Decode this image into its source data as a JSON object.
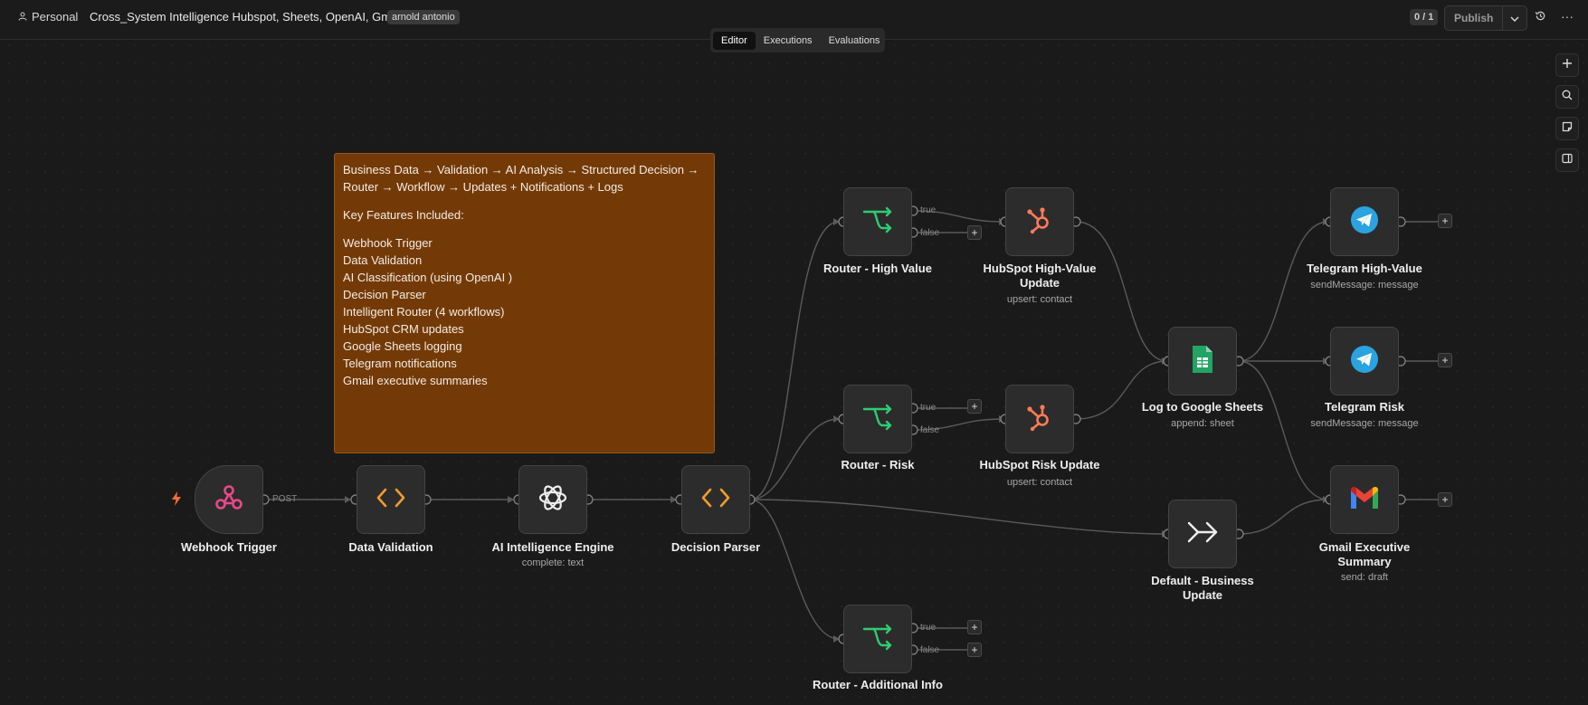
{
  "header": {
    "personal_label": "Personal",
    "workflow_title": "Cross_System Intelligence Hubspot, Sheets, OpenAI, Gmail",
    "owner_tag": "arnold antonio",
    "version_counter": "0 / 1",
    "publish_label": "Publish"
  },
  "tabs": [
    {
      "label": "Editor",
      "active": true
    },
    {
      "label": "Executions",
      "active": false
    },
    {
      "label": "Evaluations",
      "active": false
    }
  ],
  "sticky_note": {
    "flow_line": "Business Data → Validation → AI Analysis → Structured Decision → Router → Workflow → Updates + Notifications + Logs",
    "features_heading": "Key Features Included:",
    "features": [
      "Webhook Trigger",
      "Data Validation",
      "AI Classification (using OpenAI )",
      "Decision Parser",
      "Intelligent Router (4 workflows)",
      "HubSpot CRM updates",
      "Google Sheets logging",
      "Telegram notifications",
      "Gmail executive summaries"
    ]
  },
  "nodes": {
    "webhook": {
      "label": "Webhook Trigger",
      "edge_label": "POST"
    },
    "validation": {
      "label": "Data Validation"
    },
    "ai_engine": {
      "label": "AI Intelligence Engine",
      "subtitle": "complete: text"
    },
    "parser": {
      "label": "Decision Parser"
    },
    "router_high": {
      "label": "Router - High Value",
      "out_true": "true",
      "out_false": "false"
    },
    "router_risk": {
      "label": "Router - Risk",
      "out_true": "true",
      "out_false": "false"
    },
    "router_info": {
      "label": "Router - Additional Info",
      "out_true": "true",
      "out_false": "false"
    },
    "hubspot_high": {
      "label": "HubSpot High-Value Update",
      "subtitle": "upsert: contact"
    },
    "hubspot_risk": {
      "label": "HubSpot Risk Update",
      "subtitle": "upsert: contact"
    },
    "sheets": {
      "label": "Log to Google Sheets",
      "subtitle": "append: sheet"
    },
    "default_update": {
      "label": "Default - Business Update"
    },
    "telegram_high": {
      "label": "Telegram High-Value",
      "subtitle": "sendMessage: message"
    },
    "telegram_risk": {
      "label": "Telegram Risk",
      "subtitle": "sendMessage: message"
    },
    "gmail": {
      "label": "Gmail Executive Summary",
      "subtitle": "send: draft"
    }
  },
  "colors": {
    "canvas_bg": "#1a1a1a",
    "node_bg": "#2c2c2c",
    "sticky_bg": "#733a08",
    "router_icon": "#2ecc71",
    "code_icon": "#f39c2c",
    "hubspot": "#ff7a59",
    "webhook": "#e8488a",
    "telegram": "#2aa3e0",
    "sheets": "#21a464",
    "trigger_bolt": "#ff6b35"
  },
  "icons": {
    "webhook": "webhook-icon",
    "validation": "code-icon",
    "ai_engine": "openai-icon",
    "parser": "code-icon",
    "routers": "router-icon",
    "hubspot": "hubspot-icon",
    "sheets": "google-sheets-icon",
    "default_update": "double-arrow-icon",
    "telegram": "telegram-icon",
    "gmail": "gmail-icon"
  }
}
